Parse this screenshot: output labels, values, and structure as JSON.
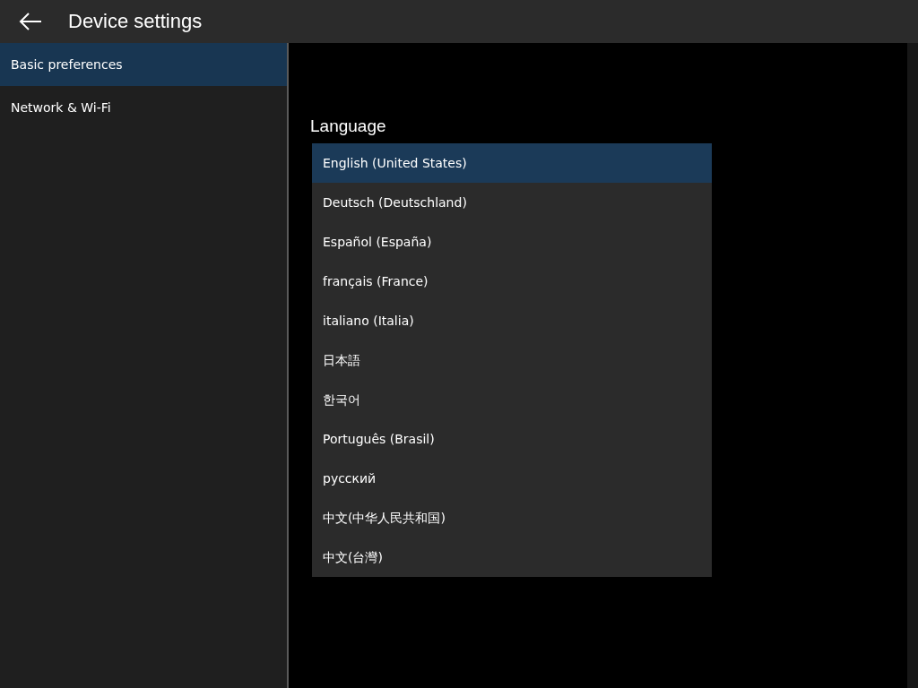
{
  "header": {
    "title": "Device settings"
  },
  "sidebar": {
    "items": [
      {
        "label": "Basic preferences",
        "selected": true
      },
      {
        "label": "Network & Wi-Fi",
        "selected": false
      }
    ]
  },
  "language": {
    "label": "Language",
    "options": [
      {
        "label": "English (United States)",
        "selected": true
      },
      {
        "label": "Deutsch (Deutschland)",
        "selected": false
      },
      {
        "label": "Español (España)",
        "selected": false
      },
      {
        "label": "français (France)",
        "selected": false
      },
      {
        "label": "italiano (Italia)",
        "selected": false
      },
      {
        "label": "日本語",
        "selected": false
      },
      {
        "label": "한국어",
        "selected": false
      },
      {
        "label": "Português (Brasil)",
        "selected": false
      },
      {
        "label": "русский",
        "selected": false
      },
      {
        "label": "中文(中华人民共和国)",
        "selected": false
      },
      {
        "label": "中文(台灣)",
        "selected": false
      }
    ]
  }
}
